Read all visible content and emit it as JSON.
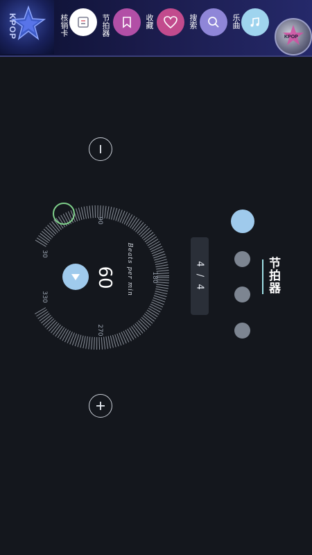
{
  "header": {
    "logo_text": "KPOP",
    "avatar_text": "KPOP",
    "nav_items": [
      {
        "id": "flashcards",
        "label": "核销卡"
      },
      {
        "id": "metronome",
        "label": "节拍器"
      },
      {
        "id": "favorites",
        "label": "收藏"
      },
      {
        "id": "search",
        "label": "搜索"
      },
      {
        "id": "songs",
        "label": "乐曲"
      }
    ]
  },
  "metronome": {
    "title": "节拍器",
    "bpm": "60",
    "bpm_caption": "Beats per min",
    "time_signature": "4 / 4",
    "dial_ticks": [
      "90",
      "180",
      "270",
      "330",
      "30"
    ],
    "beats_total": 4,
    "current_beat": 1
  },
  "colors": {
    "accent": "#9fcaec",
    "beat_inactive": "#7d8591",
    "knob": "#7fd08a",
    "underline": "#9fe0e6"
  }
}
